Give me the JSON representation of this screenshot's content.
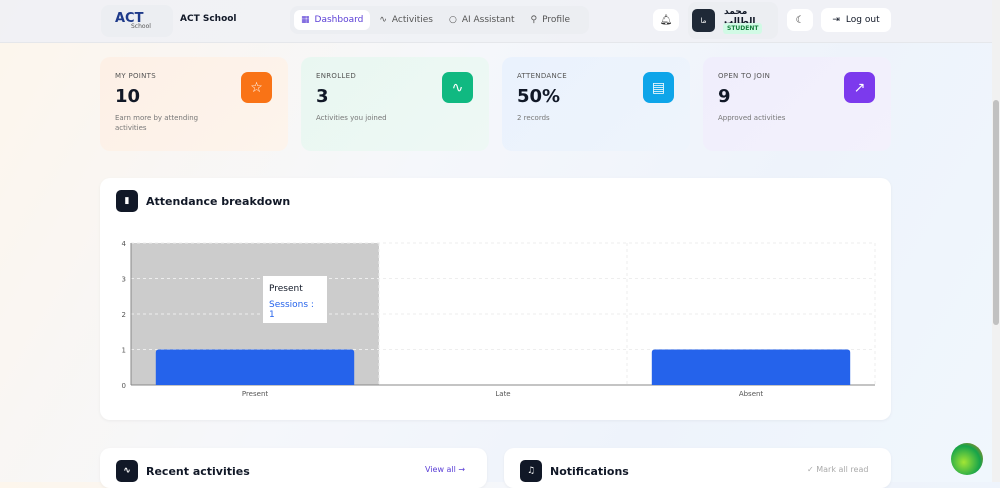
{
  "header": {
    "logo_text": "ACT",
    "logo_sub": "School",
    "brand": "ACT School",
    "nav": [
      {
        "label": "Dashboard",
        "icon": "grid-icon",
        "active": true
      },
      {
        "label": "Activities",
        "icon": "activity-icon"
      },
      {
        "label": "AI Assistant",
        "icon": "chat-icon"
      },
      {
        "label": "Profile",
        "icon": "user-icon"
      }
    ],
    "user": {
      "name": "محمد الطالب",
      "initials": "ما",
      "role": "STUDENT"
    },
    "logout": "Log out"
  },
  "stats": [
    {
      "label": "MY POINTS",
      "value": "10",
      "sub": "Earn more by attending activities",
      "icon": "star-icon",
      "color": "#f97316"
    },
    {
      "label": "ENROLLED",
      "value": "3",
      "sub": "Activities you joined",
      "icon": "activity-icon",
      "color": "#10b981"
    },
    {
      "label": "ATTENDANCE",
      "value": "50%",
      "sub": "2 records",
      "icon": "calendar-icon",
      "color": "#0ea5e9"
    },
    {
      "label": "OPEN TO JOIN",
      "value": "9",
      "sub": "Approved activities",
      "icon": "trending-up-icon",
      "color": "#7c3aed"
    }
  ],
  "chart_title": "Attendance breakdown",
  "chart_data": {
    "type": "bar",
    "categories": [
      "Present",
      "Late",
      "Absent"
    ],
    "values": [
      1,
      0,
      1
    ],
    "ylim": [
      0,
      4
    ],
    "yticks": [
      0,
      1,
      2,
      3,
      4
    ],
    "color": "#2563eb",
    "tooltip": {
      "title": "Present",
      "text": "Sessions : 1"
    }
  },
  "recent": {
    "title": "Recent activities",
    "link": "View all →"
  },
  "notifications": {
    "title": "Notifications",
    "link": "✓ Mark all read"
  }
}
